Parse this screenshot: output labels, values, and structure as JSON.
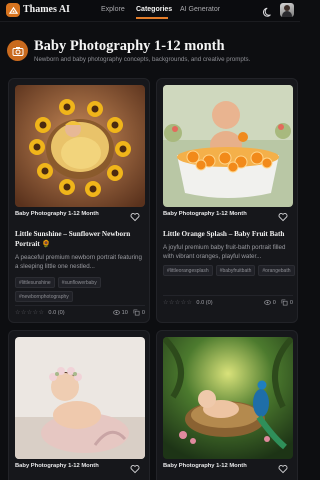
{
  "app": {
    "name": "Thames AI"
  },
  "nav": {
    "explore": "Explore",
    "categories": "Categories",
    "ai_generator": "AI Generator"
  },
  "category": {
    "title": "Baby Photography 1-12 month",
    "description": "Newborn and baby photography concepts, backgrounds, and creative prompts."
  },
  "cards": [
    {
      "category": "Baby Photography 1-12 Month",
      "title": "Little Sunshine – Sunflower Newborn Portrait 🌻",
      "description": "A peaceful premium newborn portrait featuring a sleeping little one nestled...",
      "tags": [
        "#littlesunshine",
        "#sunflowerbaby",
        "#newbornphotography"
      ],
      "rating": "0.0 (0)",
      "views": "10",
      "copies": "0"
    },
    {
      "category": "Baby Photography 1-12 Month",
      "title": "Little Orange Splash – Baby Fruit Bath",
      "description": "A joyful premium baby fruit-bath portrait filled with vibrant oranges, playful water...",
      "tags": [
        "#littleorangesplash",
        "#babyfruitbath",
        "#orangebath"
      ],
      "rating": "0.0 (0)",
      "views": "0",
      "copies": "0"
    },
    {
      "category": "Baby Photography 1-12 Month"
    },
    {
      "category": "Baby Photography 1-12 Month"
    }
  ],
  "colors": {
    "accent": "#e37d2a",
    "background": "#0d0e11",
    "card": "#16171b"
  }
}
